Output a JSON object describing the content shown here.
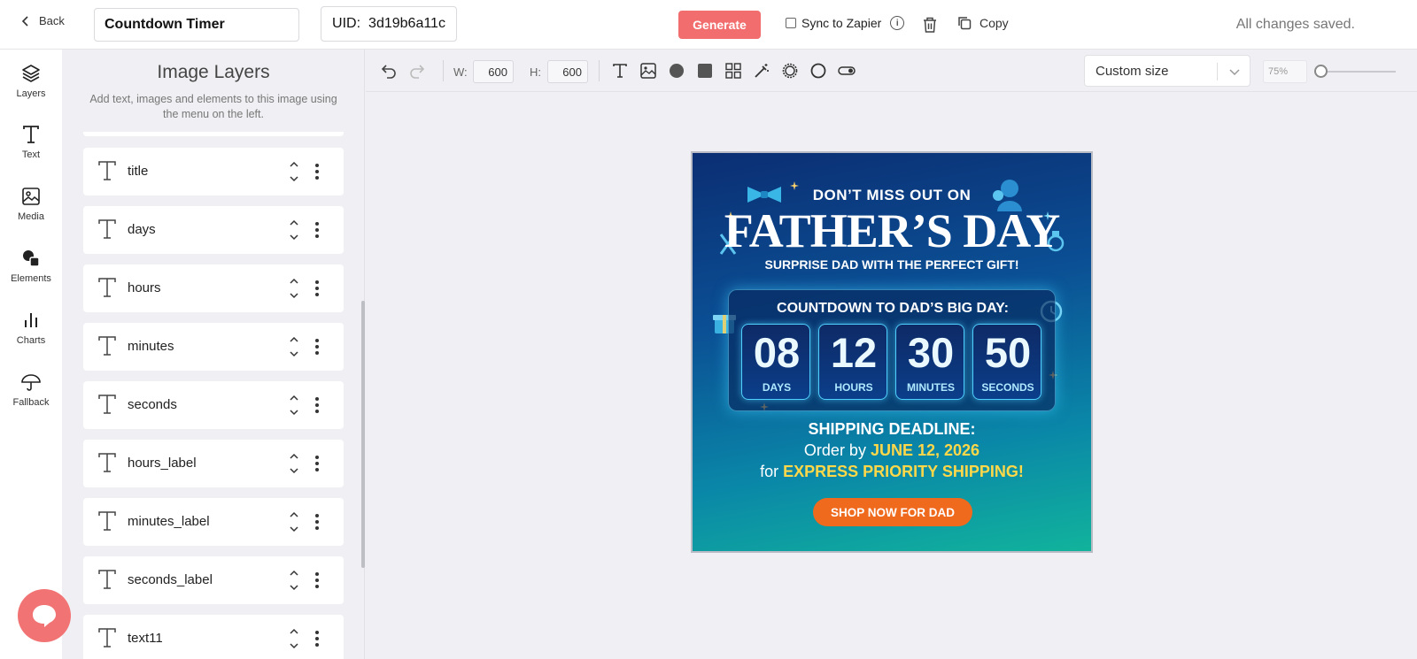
{
  "topbar": {
    "back_label": "Back",
    "template_name": "Countdown Timer",
    "uid_label": "UID:",
    "uid_value": "3d19b6a11c",
    "generate_label": "Generate",
    "sync_label": "Sync to Zapier",
    "copy_label": "Copy",
    "save_status": "All changes saved."
  },
  "rail": {
    "items": [
      {
        "label": "Layers",
        "icon": "layers-icon"
      },
      {
        "label": "Text",
        "icon": "text-icon"
      },
      {
        "label": "Media",
        "icon": "image-icon"
      },
      {
        "label": "Elements",
        "icon": "shapes-icon"
      },
      {
        "label": "Charts",
        "icon": "bar-chart-icon"
      },
      {
        "label": "Fallback",
        "icon": "umbrella-icon"
      }
    ]
  },
  "panel": {
    "title": "Image Layers",
    "subtitle": "Add text, images and elements to this image using the menu on the left.",
    "layers": [
      "title",
      "days",
      "hours",
      "minutes",
      "seconds",
      "hours_label",
      "minutes_label",
      "seconds_label",
      "text11"
    ]
  },
  "toolbar": {
    "width_label": "W:",
    "width_value": "600",
    "height_label": "H:",
    "height_value": "600",
    "size_option": "Custom size",
    "zoom": "75%",
    "zoom_fraction": 0.0
  },
  "banner": {
    "top_line": "DON’T MISS OUT ON",
    "title": "FATHER’S DAY",
    "subtitle": "SURPRISE DAD WITH THE PERFECT GIFT!",
    "countdown_heading": "COUNTDOWN TO DAD’S BIG DAY:",
    "units": [
      {
        "value": "08",
        "label": "DAYS"
      },
      {
        "value": "12",
        "label": "HOURS"
      },
      {
        "value": "30",
        "label": "MINUTES"
      },
      {
        "value": "50",
        "label": "SECONDS"
      }
    ],
    "shipping_heading": "SHIPPING DEADLINE:",
    "order_prefix": "Order by",
    "order_date": "JUNE 12, 2026",
    "express_prefix": "for",
    "express_text": "EXPRESS PRIORITY SHIPPING!",
    "cta": "SHOP NOW FOR DAD"
  },
  "colors": {
    "accent": "#f26d6d",
    "cta": "#f06a1e",
    "highlight": "#ffd84a"
  }
}
